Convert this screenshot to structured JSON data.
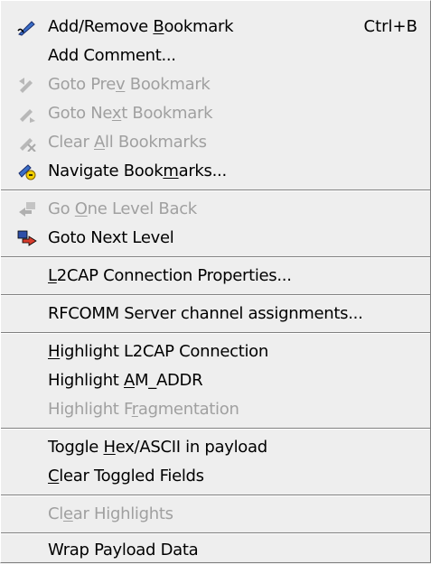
{
  "menu": {
    "items": [
      {
        "id": "add_remove_bookmark",
        "label": "Add/Remove Bookmark",
        "mnemonic": "B",
        "shortcut": "Ctrl+B",
        "disabled": false,
        "icon": "pen-bookmark-icon"
      },
      {
        "id": "add_comment",
        "label": "Add Comment...",
        "disabled": false,
        "icon": ""
      },
      {
        "id": "goto_prev_bookmark",
        "label": "Goto Prev Bookmark",
        "mnemonic": "v",
        "disabled": true,
        "icon": "prev-bookmark-icon"
      },
      {
        "id": "goto_next_bookmark",
        "label": "Goto Next Bookmark",
        "mnemonic": "x",
        "disabled": true,
        "icon": "next-bookmark-icon"
      },
      {
        "id": "clear_all_bookmarks",
        "label": "Clear All Bookmarks",
        "mnemonic": "A",
        "disabled": true,
        "icon": "clear-bookmarks-icon"
      },
      {
        "id": "navigate_bookmarks",
        "label": "Navigate Bookmarks...",
        "mnemonic": "m",
        "disabled": false,
        "icon": "navigate-bookmarks-icon"
      },
      {
        "id": "go_one_level_back",
        "label": "Go One Level Back",
        "mnemonic": "O",
        "disabled": true,
        "icon": "level-back-icon"
      },
      {
        "id": "goto_next_level",
        "label": "Goto Next Level",
        "disabled": false,
        "icon": "next-level-icon"
      },
      {
        "id": "l2cap_connection_properties",
        "label": "L2CAP Connection Properties...",
        "mnemonic": "L",
        "disabled": false,
        "icon": ""
      },
      {
        "id": "rfcomm_server_channel",
        "label": "RFCOMM Server channel assignments...",
        "disabled": false,
        "icon": ""
      },
      {
        "id": "highlight_l2cap",
        "label": "Highlight L2CAP Connection",
        "mnemonic": "H",
        "disabled": false,
        "icon": ""
      },
      {
        "id": "highlight_am_addr",
        "label": "Highlight AM_ADDR",
        "mnemonic": "A",
        "disabled": false,
        "icon": ""
      },
      {
        "id": "highlight_fragmentation",
        "label": "Highlight Fragmentation",
        "mnemonic": "r",
        "disabled": true,
        "icon": ""
      },
      {
        "id": "toggle_hex_ascii",
        "label": "Toggle Hex/ASCII in payload",
        "mnemonic": "H",
        "disabled": false,
        "icon": ""
      },
      {
        "id": "clear_toggled_fields",
        "label": "Clear Toggled Fields",
        "mnemonic": "C",
        "disabled": false,
        "icon": ""
      },
      {
        "id": "clear_highlights",
        "label": "Clear Highlights",
        "mnemonic": "e",
        "disabled": true,
        "icon": ""
      },
      {
        "id": "wrap_payload_data",
        "label": "Wrap Payload Data",
        "disabled": false,
        "icon": ""
      }
    ]
  }
}
